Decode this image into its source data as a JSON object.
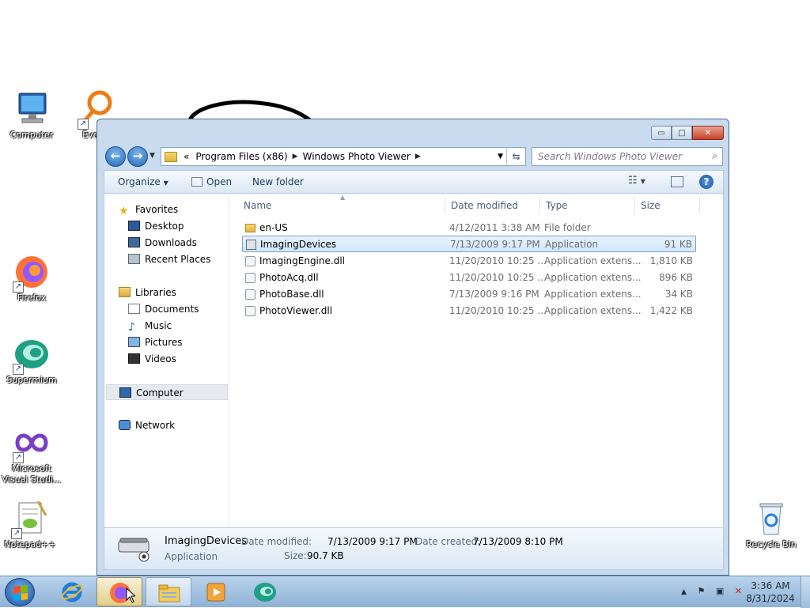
{
  "desktop": {
    "icons": [
      {
        "name": "computer",
        "label": "Computer"
      },
      {
        "name": "everything",
        "label": "Everyt"
      },
      {
        "name": "firefox",
        "label": "Firefox"
      },
      {
        "name": "supermium",
        "label": "Supermium"
      },
      {
        "name": "visual-studio",
        "label": "Microsoft Visual Studi..."
      },
      {
        "name": "notepadpp",
        "label": "Notepad++"
      },
      {
        "name": "recycle-bin",
        "label": "Recycle Bin"
      }
    ]
  },
  "window": {
    "caption_buttons": {
      "minimize": "▭",
      "maximize": "□",
      "close": "✕"
    },
    "nav": {
      "back": "←",
      "forward": "→"
    },
    "address": {
      "overflow": "«",
      "segments": [
        "Program Files (x86)",
        "Windows Photo Viewer"
      ]
    },
    "search": {
      "placeholder": "Search Windows Photo Viewer"
    },
    "toolbar": {
      "organize": "Organize",
      "open": "Open",
      "new_folder": "New folder"
    },
    "nav_pane": {
      "favorites": "Favorites",
      "desktop": "Desktop",
      "downloads": "Downloads",
      "recent_places": "Recent Places",
      "libraries": "Libraries",
      "documents": "Documents",
      "music": "Music",
      "pictures": "Pictures",
      "videos": "Videos",
      "computer": "Computer",
      "network": "Network"
    },
    "columns": {
      "name": "Name",
      "date_modified": "Date modified",
      "type": "Type",
      "size": "Size"
    },
    "files": [
      {
        "name": "en-US",
        "date": "4/12/2011 3:38 AM",
        "type": "File folder",
        "size": "",
        "kind": "folder",
        "selected": false
      },
      {
        "name": "ImagingDevices",
        "date": "7/13/2009 9:17 PM",
        "type": "Application",
        "size": "91 KB",
        "kind": "app",
        "selected": true
      },
      {
        "name": "ImagingEngine.dll",
        "date": "11/20/2010 10:25 ...",
        "type": "Application extens...",
        "size": "1,810 KB",
        "kind": "dll",
        "selected": false
      },
      {
        "name": "PhotoAcq.dll",
        "date": "11/20/2010 10:25 ...",
        "type": "Application extens...",
        "size": "896 KB",
        "kind": "dll",
        "selected": false
      },
      {
        "name": "PhotoBase.dll",
        "date": "7/13/2009 9:16 PM",
        "type": "Application extens...",
        "size": "34 KB",
        "kind": "dll",
        "selected": false
      },
      {
        "name": "PhotoViewer.dll",
        "date": "11/20/2010 10:25 ...",
        "type": "Application extens...",
        "size": "1,422 KB",
        "kind": "dll",
        "selected": false
      }
    ],
    "details": {
      "name": "ImagingDevices",
      "kind": "Application",
      "date_modified_label": "Date modified:",
      "date_modified": "7/13/2009 9:17 PM",
      "size_label": "Size:",
      "size": "90.7 KB",
      "date_created_label": "Date created:",
      "date_created": "7/13/2009 8:10 PM"
    }
  },
  "taskbar": {
    "pinned": [
      "internet-explorer",
      "firefox",
      "windows-explorer",
      "media-player",
      "supermium"
    ],
    "clock": {
      "time": "3:36 AM",
      "date": "8/31/2024"
    }
  }
}
